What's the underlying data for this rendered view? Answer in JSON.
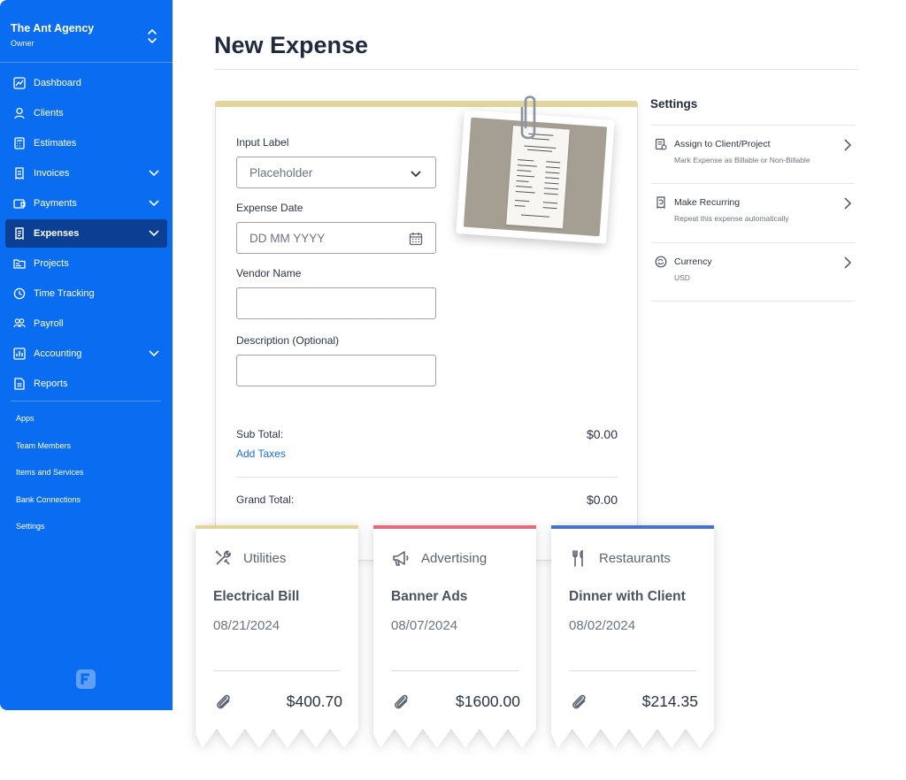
{
  "sidebar": {
    "company": "The Ant Agency",
    "role": "Owner",
    "nav": [
      {
        "label": "Dashboard",
        "icon": "chart-line-icon"
      },
      {
        "label": "Clients",
        "icon": "users-icon"
      },
      {
        "label": "Estimates",
        "icon": "calculator-icon"
      },
      {
        "label": "Invoices",
        "icon": "invoice-icon"
      },
      {
        "label": "Payments",
        "icon": "payment-icon"
      },
      {
        "label": "Expenses",
        "icon": "receipt-icon"
      },
      {
        "label": "Projects",
        "icon": "folder-icon"
      },
      {
        "label": "Time Tracking",
        "icon": "clock-icon"
      },
      {
        "label": "Payroll",
        "icon": "people-icon"
      },
      {
        "label": "Accounting",
        "icon": "ledger-icon"
      },
      {
        "label": "Reports",
        "icon": "report-icon"
      }
    ],
    "links": [
      "Apps",
      "Team Members",
      "Items and Services",
      "Bank Connections",
      "Settings"
    ]
  },
  "header": {
    "title": "New Expense"
  },
  "form": {
    "input_label": "Input Label",
    "input_placeholder": "Placeholder",
    "date_label": "Expense Date",
    "date_placeholder": "DD MM YYYY",
    "vendor_label": "Vendor Name",
    "description_label": "Description (Optional)",
    "subtotal_label": "Sub Total:",
    "subtotal_value": "$0.00",
    "add_taxes": "Add Taxes",
    "grand_total_label": "Grand Total:",
    "grand_total_value": "$0.00"
  },
  "settings": {
    "title": "Settings",
    "items": [
      {
        "title": "Assign to Client/Project",
        "subtitle": "Mark Expense as Billable or Non-Billable",
        "icon": "assign-icon"
      },
      {
        "title": "Make Recurring",
        "subtitle": "Repeat this expense automatically",
        "icon": "recurring-icon"
      },
      {
        "title": "Currency",
        "subtitle": "USD",
        "icon": "currency-icon"
      }
    ]
  },
  "expense_cards": [
    {
      "category": "Utilities",
      "title": "Electrical Bill",
      "date": "08/21/2024",
      "amount": "$400.70",
      "accent": "#e2d49a",
      "icon": "tools-icon"
    },
    {
      "category": "Advertising",
      "title": "Banner Ads",
      "date": "08/07/2024",
      "amount": "$1600.00",
      "accent": "#e46a7e",
      "icon": "megaphone-icon"
    },
    {
      "category": "Restaurants",
      "title": "Dinner with Client",
      "date": "08/02/2024",
      "amount": "$214.35",
      "accent": "#4a72c9",
      "icon": "utensils-icon"
    }
  ],
  "colors": {
    "sidebar": "#0a6cf0",
    "sidebar_active": "#0b3f94",
    "link": "#1a6fe0"
  }
}
